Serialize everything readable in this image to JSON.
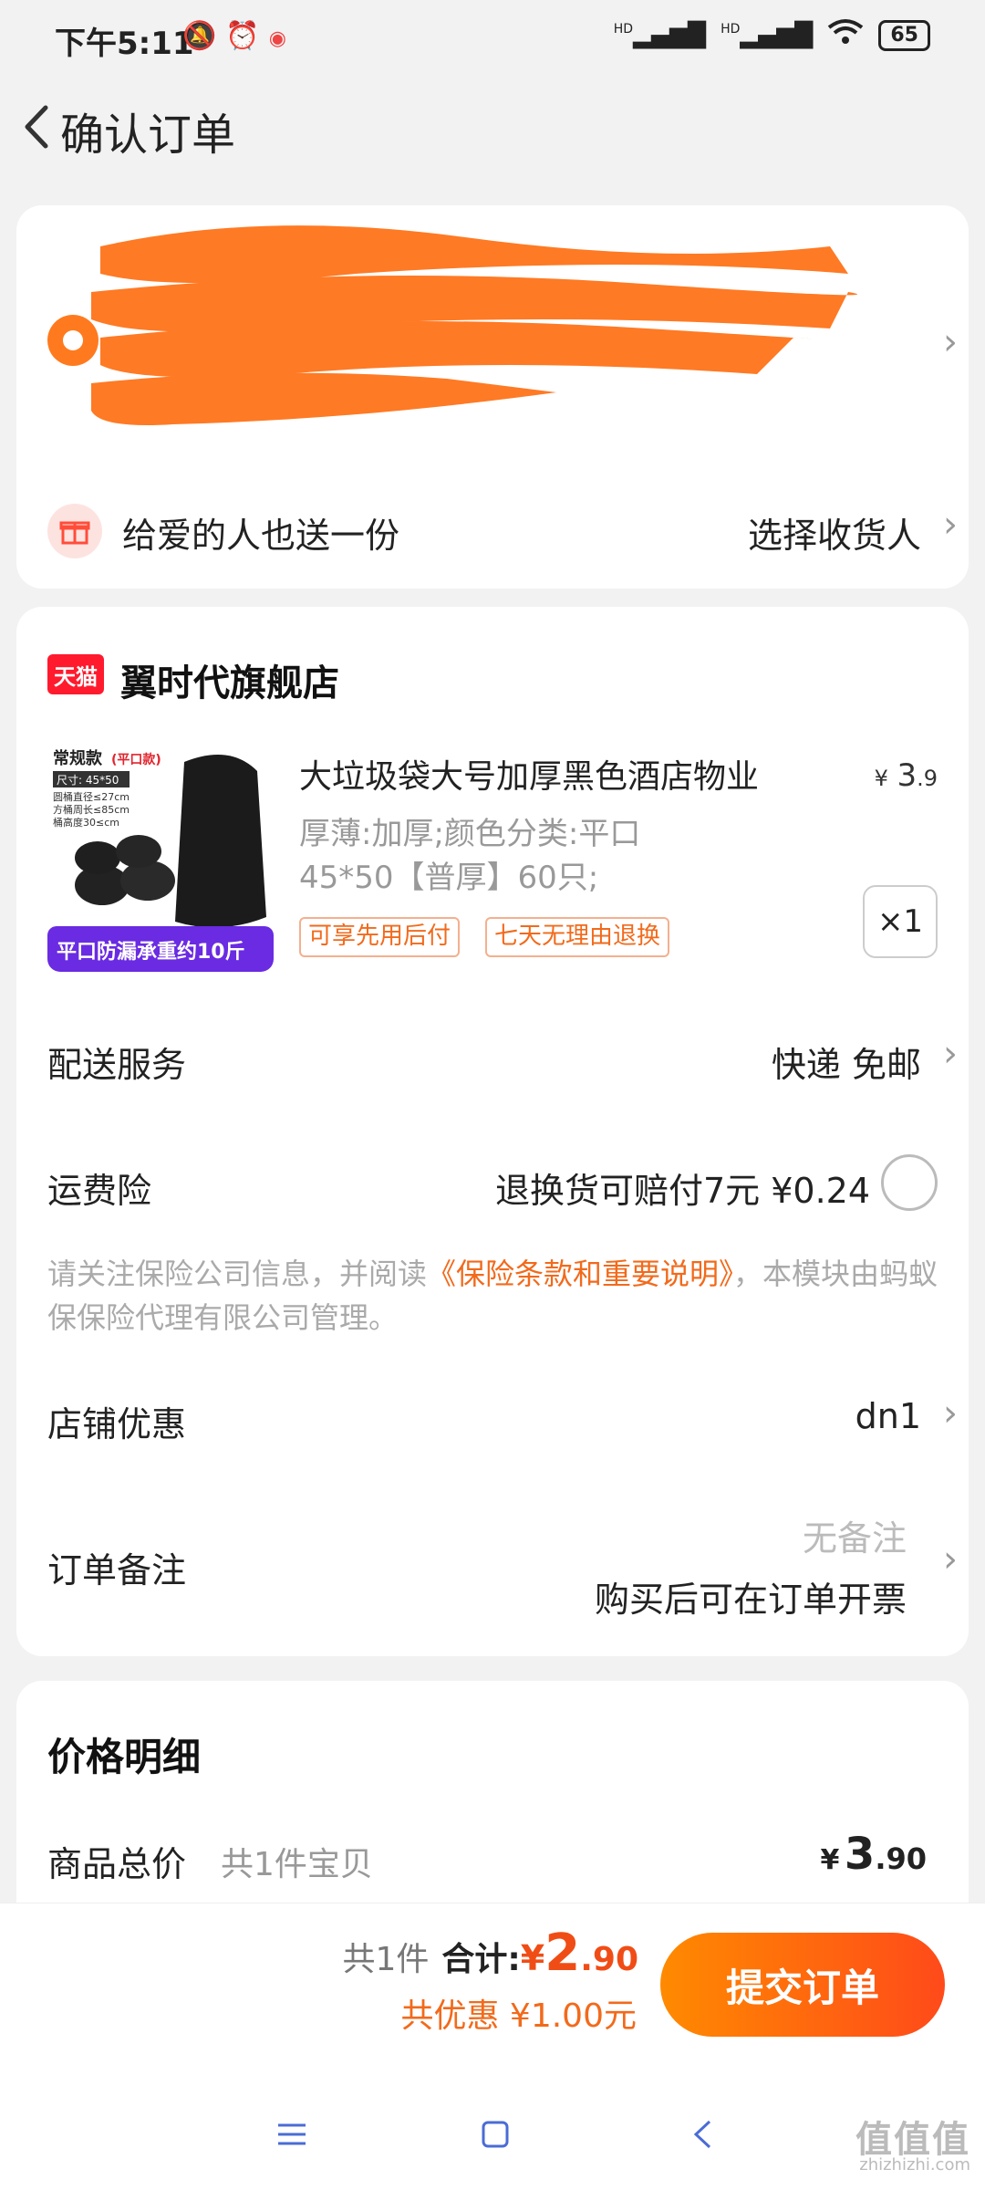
{
  "status_bar": {
    "time": "下午5:11",
    "signal1": "HD",
    "signal2": "HD",
    "battery": "65"
  },
  "header": {
    "title": "确认订单"
  },
  "address": {
    "gift_text": "给爱的人也送一份",
    "choose_receiver": "选择收货人"
  },
  "store": {
    "badge": "天猫",
    "name": "翼时代旗舰店"
  },
  "product": {
    "title": "大垃圾袋大号加厚黑色酒店物业",
    "price_symbol": "¥",
    "price_int": "3",
    "price_dec": ".9",
    "spec_line1": "厚薄:加厚;颜色分类:平口",
    "spec_line2": "45*50【普厚】60只;",
    "tags": [
      "可享先用后付",
      "七天无理由退换"
    ],
    "quantity": "×1",
    "image_text": {
      "top": "常规款",
      "top_tag": "(平口款)",
      "size_label": "尺寸:  45*50",
      "detail1": "圆桶直径≤27cm",
      "detail2": "方桶周长≤85cm",
      "detail3": "桶高度30≤cm",
      "banner": "平口防漏承重约10斤"
    }
  },
  "delivery": {
    "label": "配送服务",
    "value": "快递 免邮"
  },
  "insurance": {
    "label": "运费险",
    "value": "退换货可赔付7元  ¥0.24",
    "note_prefix": "请关注保险公司信息，并阅读",
    "note_link": "《保险条款和重要说明》",
    "note_suffix": "，本模块由蚂蚁保保险代理有限公司管理。"
  },
  "store_discount": {
    "label": "店铺优惠",
    "value": "dn1"
  },
  "memo": {
    "label": "订单备注",
    "value": "无备注",
    "sub": "购买后可在订单开票"
  },
  "price_detail": {
    "title": "价格明细",
    "total_label": "商品总价",
    "total_sub": "共1件宝贝",
    "total_symbol": "¥",
    "total_int": "3",
    "total_dec": ".90"
  },
  "bottom": {
    "count": "共1件",
    "sum_label": "合计:",
    "sum_symbol": "¥",
    "sum_int": "2",
    "sum_dec": ".90",
    "saving": "共优惠 ¥1.00元",
    "submit": "提交订单"
  },
  "watermark": {
    "main": "值值值",
    "sub": "zhizhizhi.com"
  },
  "colors": {
    "accent": "#ff6a1a",
    "tmall_red": "#ff1a2e",
    "nav_blue": "#4a6cd6"
  }
}
